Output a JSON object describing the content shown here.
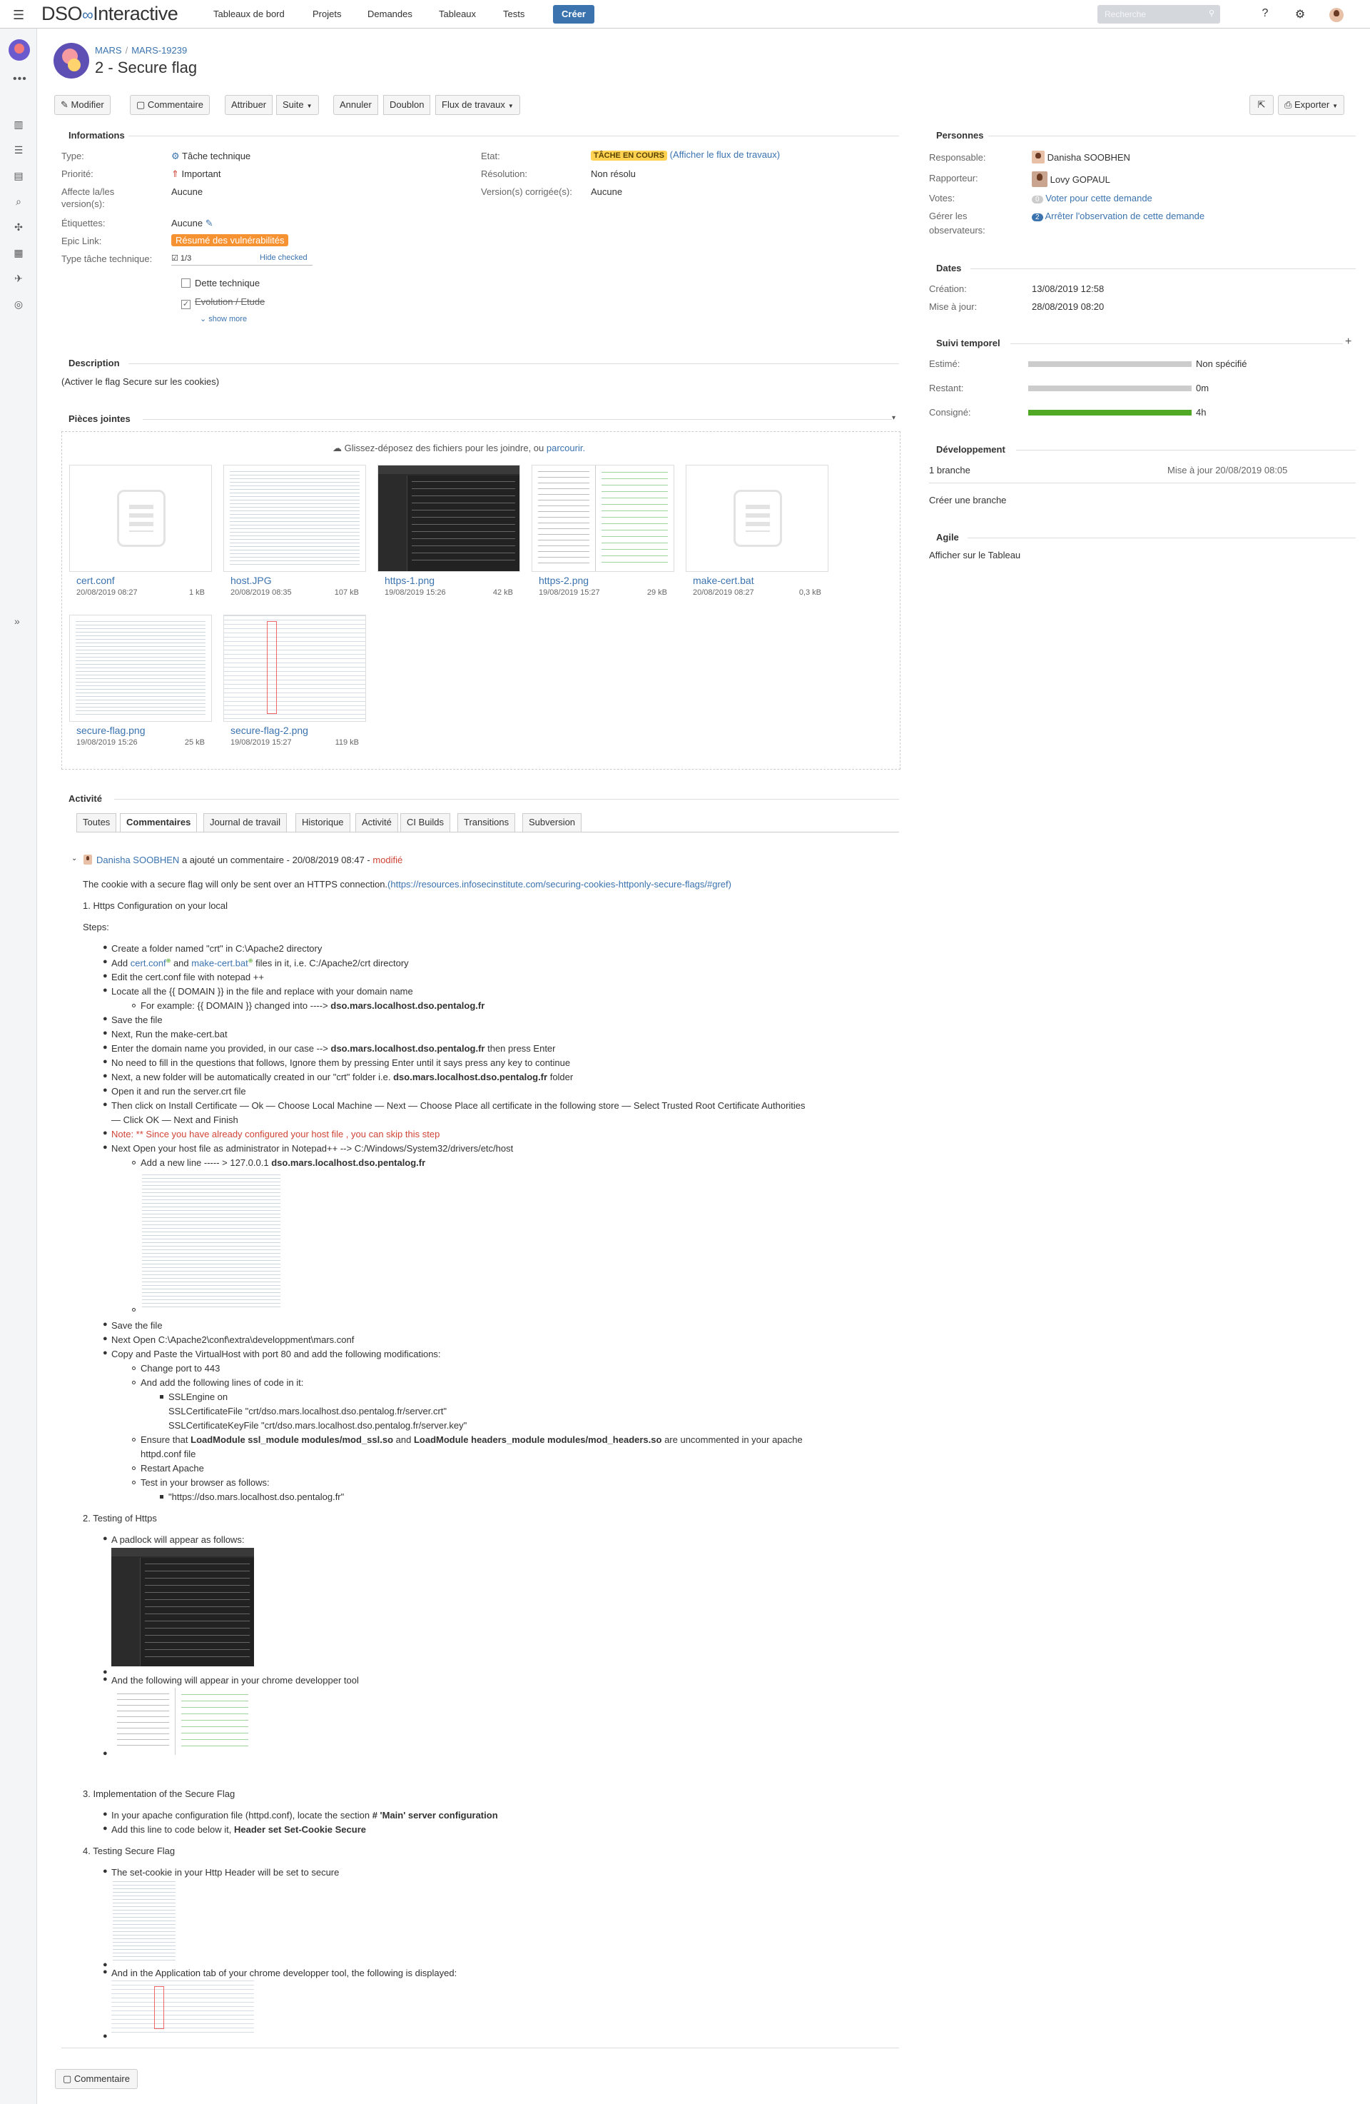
{
  "header": {
    "logo_text": "DSO",
    "logo_suffix": "Interactive",
    "nav": [
      "Tableaux de bord",
      "Projets",
      "Demandes",
      "Tableaux",
      "Tests"
    ],
    "create_label": "Créer",
    "search_placeholder": "Recherche"
  },
  "breadcrumb": {
    "project": "MARS",
    "issue_key": "MARS-19239"
  },
  "issue": {
    "title": "2 - Secure flag"
  },
  "toolbar": {
    "edit": "Modifier",
    "comment": "Commentaire",
    "assign": "Attribuer",
    "more": "Suite",
    "cancel": "Annuler",
    "duplicate": "Doublon",
    "workflow": "Flux de travaux",
    "export": "Exporter"
  },
  "details": {
    "heading": "Informations",
    "type_label": "Type:",
    "type_value": "Tâche technique",
    "priority_label": "Priorité:",
    "priority_value": "Important",
    "affects_label": "Affecte la/les",
    "affects_label2": "version(s):",
    "affects_value": "Aucune",
    "labels_label": "Étiquettes:",
    "labels_value": "Aucune",
    "epic_label": "Epic Link:",
    "epic_value": "Résumé des vulnérabilités",
    "techtype_label": "Type tâche technique:",
    "techtype_count": "1/3",
    "hide_checked": "Hide checked",
    "option1": "Dette technique",
    "option2": "Evolution / Etude",
    "show_more": "show more",
    "state_label": "Etat:",
    "state_value": "TÂCHE EN COURS",
    "state_link": "(Afficher le flux de travaux)",
    "resolution_label": "Résolution:",
    "resolution_value": "Non résolu",
    "fix_label": "Version(s) corrigée(s):",
    "fix_value": "Aucune"
  },
  "description": {
    "heading": "Description",
    "text": "(Activer le flag Secure sur les cookies)"
  },
  "attachments": {
    "heading": "Pièces jointes",
    "drop_text": "Glissez-déposez des fichiers pour les joindre, ou",
    "drop_link": "parcourir.",
    "files": [
      {
        "name": "cert.conf",
        "date": "20/08/2019 08:27",
        "size": "1 kB"
      },
      {
        "name": "host.JPG",
        "date": "20/08/2019 08:35",
        "size": "107 kB"
      },
      {
        "name": "https-1.png",
        "date": "19/08/2019 15:26",
        "size": "42 kB"
      },
      {
        "name": "https-2.png",
        "date": "19/08/2019 15:27",
        "size": "29 kB"
      },
      {
        "name": "make-cert.bat",
        "date": "20/08/2019 08:27",
        "size": "0,3 kB"
      },
      {
        "name": "secure-flag.png",
        "date": "19/08/2019 15:26",
        "size": "25 kB"
      },
      {
        "name": "secure-flag-2.png",
        "date": "19/08/2019 15:27",
        "size": "119 kB"
      }
    ]
  },
  "people": {
    "heading": "Personnes",
    "assignee_label": "Responsable:",
    "assignee": "Danisha SOOBHEN",
    "reporter_label": "Rapporteur:",
    "reporter": "Lovy GOPAUL",
    "votes_label": "Votes:",
    "votes_count": "0",
    "votes_link": "Voter pour cette demande",
    "watchers_label": "Gérer les",
    "watchers_label2": "observateurs:",
    "watchers_count": "2",
    "watchers_link": "Arrêter l'observation de cette demande"
  },
  "dates": {
    "heading": "Dates",
    "created_label": "Création:",
    "created": "13/08/2019 12:58",
    "updated_label": "Mise à jour:",
    "updated": "28/08/2019 08:20"
  },
  "time_tracking": {
    "heading": "Suivi temporel",
    "estimated_label": "Estimé:",
    "estimated": "Non spécifié",
    "remaining_label": "Restant:",
    "remaining": "0m",
    "logged_label": "Consigné:",
    "logged": "4h",
    "logged_fraction": 1.0
  },
  "development": {
    "heading": "Développement",
    "branch": "1 branche",
    "branch_updated": "Mise à jour 20/08/2019 08:05",
    "create_branch": "Créer une branche"
  },
  "agile": {
    "heading": "Agile",
    "link": "Afficher sur le Tableau"
  },
  "activity": {
    "heading": "Activité",
    "tabs": [
      "Toutes",
      "Commentaires",
      "Journal de travail",
      "Historique",
      "Activité",
      "CI Builds",
      "Transitions",
      "Subversion"
    ],
    "comment": {
      "author": "Danisha SOOBHEN",
      "meta": "a ajouté un commentaire - 20/08/2019 08:47 -",
      "modified": "modifié",
      "intro": "The cookie with a secure flag will only be sent over an HTTPS connection.",
      "intro_link": "(https://resources.infosecinstitute.com/securing-cookies-httponly-secure-flags/#gref)",
      "s1_title": "1. Https Configuration on your local",
      "steps_label": "Steps:",
      "s1_steps": {
        "a": "Create a folder named \"crt\" in C:\\Apache2 directory",
        "b1": "Add",
        "b_link1": "cert.conf",
        "b2": "and",
        "b_link2": "make-cert.bat",
        "b3": "files in it, i.e. C:/Apache2/crt directory",
        "c": "Edit the cert.conf file with notepad ++",
        "d": "Locate all the {{ DOMAIN }} in the file and replace with your domain name",
        "d_sub1": "For example: {{ DOMAIN }} changed into ---->",
        "d_sub_bold": "dso.mars.localhost.dso.pentalog.fr",
        "e": "Save the file",
        "f": "Next, Run the make-cert.bat",
        "g1": "Enter the domain name you provided, in our case -->",
        "g_bold": "dso.mars.localhost.dso.pentalog.fr",
        "g2": "then press Enter",
        "h": "No need to fill in the questions that follows, Ignore them by pressing Enter until it says press any key to continue",
        "i1": "Next, a new folder will be automatically created in our \"crt\" folder i.e.",
        "i_bold": "dso.mars.localhost.dso.pentalog.fr",
        "i2": "folder",
        "j": "Open it and run the server.crt file",
        "k1": "Then click on Install Certificate — Ok — Choose Local Machine — Next — Choose Place all certificate in the following store — Select Trusted Root Certificate Authorities",
        "k2": "— Click OK — Next and Finish",
        "l": "Note: ** Since you have already configured your host file , you can skip this step",
        "m": "Next Open your host file as administrator in Notepad++ --> C:/Windows/System32/drivers/etc/host",
        "m_sub1": "Add a new line ----- > 127.0.0.1",
        "m_sub_bold": "dso.mars.localhost.dso.pentalog.fr",
        "n": "Save the file",
        "o": "Next Open C:\\Apache2\\conf\\extra\\developpment\\mars.conf",
        "p": "Copy and Paste the VirtualHost with port 80 and add the following modifications:",
        "p_sub1": "Change port to 443",
        "p_sub2": "And add the following lines of code in it:",
        "code1": "SSLEngine on",
        "code2": "SSLCertificateFile \"crt/dso.mars.localhost.dso.pentalog.fr/server.crt\"",
        "code3": "SSLCertificateKeyFile \"crt/dso.mars.localhost.dso.pentalog.fr/server.key\"",
        "p_sub3a": "Ensure that",
        "p_sub3b": "LoadModule ssl_module modules/mod_ssl.so",
        "p_sub3c": "and",
        "p_sub3d": "LoadModule headers_module modules/mod_headers.so",
        "p_sub3e": "are uncommented in your apache",
        "p_sub3f": "httpd.conf file",
        "p_sub4": "Restart Apache",
        "p_sub5": "Test in your browser as follows:",
        "p_sub5_link": "\"https://dso.mars.localhost.dso.pentalog.fr\""
      },
      "s2_title": "2. Testing of Https",
      "s2_a": "A padlock will appear as follows:",
      "s2_b": "And the following will appear in your chrome developper tool",
      "s3_title": "3. Implementation of the Secure Flag",
      "s3_a1": "In your apache configuration file (httpd.conf), locate the section",
      "s3_a_bold": "# 'Main' server configuration",
      "s3_b1": "Add this line to code below it,",
      "s3_b_bold": "Header set Set-Cookie Secure",
      "s4_title": "4. Testing Secure Flag",
      "s4_a": "The set-cookie in your Http Header will be set to secure",
      "s4_b": "And in the Application tab of your chrome developper tool, the following is displayed:"
    },
    "comment_button": "Commentaire"
  }
}
